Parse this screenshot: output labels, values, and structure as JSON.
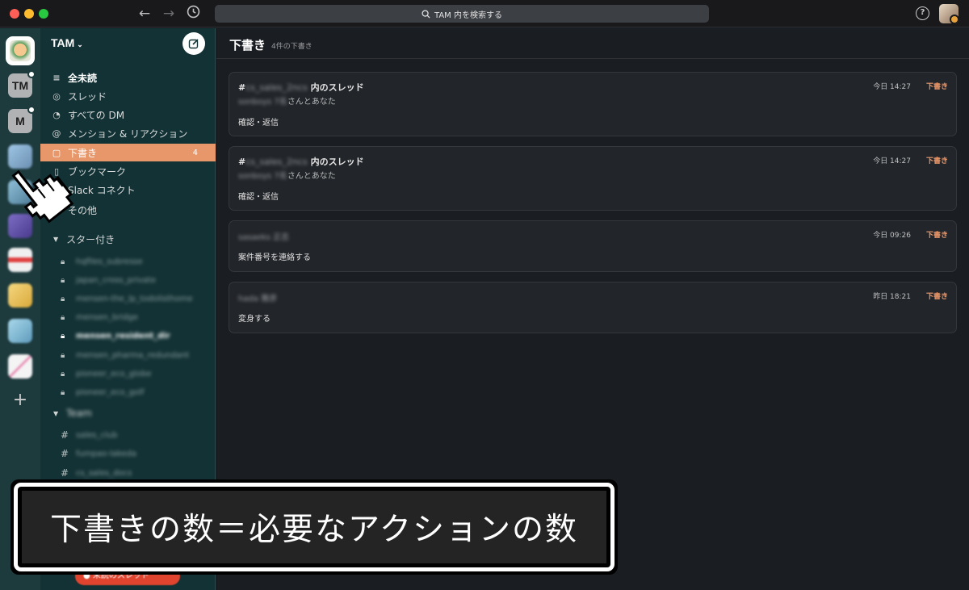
{
  "titlebar": {
    "back_icon": "arrow-left-icon",
    "forward_icon": "arrow-right-icon",
    "history_icon": "clock-icon",
    "search_placeholder": "TAM 内を検索する",
    "help_label": "?"
  },
  "rail": {
    "workspaces": [
      {
        "label": "",
        "kind": "active"
      },
      {
        "label": "TM",
        "kind": "letter",
        "badge": true
      },
      {
        "label": "M",
        "kind": "letter",
        "badge": true
      }
    ],
    "add_label": "+"
  },
  "sidebar": {
    "workspace_name": "TAM",
    "workspace_chevron": "⌄",
    "compose_icon": "compose-icon",
    "nav": [
      {
        "label": "全未読",
        "icon": "≡",
        "bold": true
      },
      {
        "label": "スレッド",
        "icon": "◎"
      },
      {
        "label": "すべての DM",
        "icon": "◔"
      },
      {
        "label": "メンション & リアクション",
        "icon": "@"
      },
      {
        "label": "下書き",
        "icon": "▢",
        "count": "4",
        "active": true
      },
      {
        "label": "ブックマーク",
        "icon": "▯"
      },
      {
        "label": "Slack コネクト",
        "icon": "◇"
      },
      {
        "label": "その他",
        "icon": "⋮"
      }
    ],
    "starred_header": "スター付き",
    "starred_channels": [
      {
        "name": "hqfiles_subresse"
      },
      {
        "name": "japan_cross_private"
      },
      {
        "name": "mensen-the_lp_todolisthome"
      },
      {
        "name": "mensen_bridge"
      },
      {
        "name": "mensen_resident_dir",
        "bold": true
      },
      {
        "name": "mensen_pharma_redundant"
      },
      {
        "name": "pioneer_eco_globe"
      },
      {
        "name": "pioneer_eco_golf"
      }
    ],
    "second_header": "Team",
    "second_channels": [
      {
        "name": "sales_club"
      },
      {
        "name": "fumpao-lakeda"
      },
      {
        "name": "cs_sales_docs"
      }
    ],
    "huddle_label": "● 未読のスレッド"
  },
  "main": {
    "title": "下書き",
    "subtitle": "4件の下書き",
    "drafts": [
      {
        "hash": "#",
        "channel": "cs_sales_2ncs",
        "title_suffix": "内のスレッド",
        "who_blur": "sonboys 7名",
        "who_suffix": "さんとあなた",
        "body": "確認・返信",
        "time": "今日 14:27",
        "badge": "下書き"
      },
      {
        "hash": "#",
        "channel": "cs_sales_2ncs",
        "title_suffix": "内のスレッド",
        "who_blur": "sonboys 7名",
        "who_suffix": "さんとあなた",
        "body": "確認・返信",
        "time": "今日 14:27",
        "badge": "下書き"
      },
      {
        "name_blur": "sasaeks 正志",
        "body": "案件番号を連絡する",
        "time": "今日 09:26",
        "badge": "下書き"
      },
      {
        "name_blur": "hada 雅彦",
        "body": "変身する",
        "time": "昨日 18:21",
        "badge": "下書き"
      }
    ]
  },
  "overlay": {
    "caption": "下書きの数＝必要なアクションの数"
  }
}
